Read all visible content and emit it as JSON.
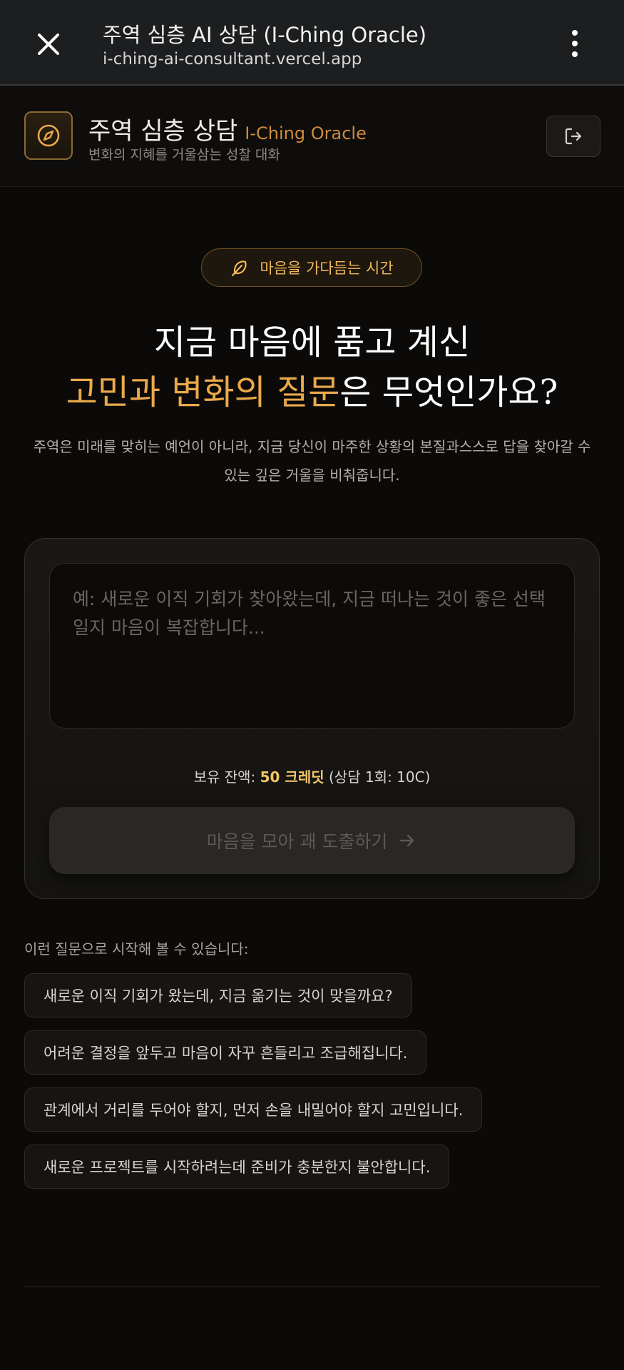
{
  "browser": {
    "title": "주역 심층 AI 상담 (I-Ching Oracle)",
    "url": "i-ching-ai-consultant.vercel.app",
    "close_icon": "close-icon",
    "menu_icon": "more-vertical-icon"
  },
  "header": {
    "logo_icon": "compass-icon",
    "title_ko": "주역 심층 상담",
    "title_en": "I-Ching Oracle",
    "subtitle": "변화의 지혜를 거울삼는 성찰 대화",
    "logout_icon": "logout-icon"
  },
  "hero": {
    "badge_icon": "feather-icon",
    "badge_text": "마음을 가다듬는 시간",
    "line1": "지금 마음에 품고 계신",
    "line2_highlight": "고민과 변화의 질문",
    "line2_rest": "은 무엇인가요?",
    "description": "주역은 미래를 맞히는 예언이 아니라, 지금 당신이 마주한 상황의 본질과스스로 답을 찾아갈 수 있는 깊은 거울을 비춰줍니다."
  },
  "form": {
    "placeholder": "예: 새로운 이직 기회가 찾아왔는데, 지금 떠나는 것이 좋은 선택일지 마음이 복잡합니다...",
    "balance_prefix": "보유 잔액: ",
    "balance_value": "50 크레딧",
    "balance_suffix": " (상담 1회: 10C)",
    "submit_label": "마음을 모아 괘 도출하기",
    "submit_icon": "arrow-right-icon"
  },
  "suggestions": {
    "label": "이런 질문으로 시작해 볼 수 있습니다:",
    "items": [
      "새로운 이직 기회가 왔는데, 지금 옮기는 것이 맞을까요?",
      "어려운 결정을 앞두고 마음이 자꾸 흔들리고 조급해집니다.",
      "관계에서 거리를 두어야 할지, 먼저 손을 내밀어야 할지 고민입니다.",
      "새로운 프로젝트를 시작하려는데 준비가 충분한지 불안합니다."
    ]
  },
  "colors": {
    "accent": "#e9a94a",
    "background": "#0b0a09",
    "card": "#1a1816"
  }
}
